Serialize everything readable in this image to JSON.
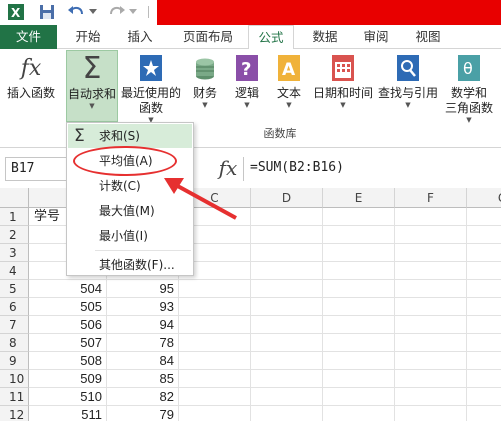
{
  "ribbon_tabs": [
    "文件",
    "开始",
    "插入",
    "页面布局",
    "公式",
    "数据",
    "审阅",
    "视图"
  ],
  "ribbon_buttons": {
    "insert_function": "插入函数",
    "autosum": "自动求和",
    "recent_line1": "最近使用的",
    "recent_line2": "函数",
    "financial": "财务",
    "logical": "逻辑",
    "text": "文本",
    "datetime": "日期和时间",
    "lookup": "查找与引用",
    "math_line1": "数学和",
    "math_line2": "三角函数"
  },
  "group_label": "函数库",
  "name_box": "B17",
  "formula": "=SUM(B2:B16)",
  "fx_label": "fx",
  "menu": {
    "items": [
      "求和(S)",
      "平均值(A)",
      "计数(C)",
      "最大值(M)",
      "最小值(I)",
      "其他函数(F)..."
    ]
  },
  "columns": [
    "C",
    "D",
    "E",
    "F",
    "G"
  ],
  "rows": [
    {
      "n": "1",
      "a": "学号",
      "b": ""
    },
    {
      "n": "2",
      "a": "",
      "b": ""
    },
    {
      "n": "3",
      "a": "",
      "b": ""
    },
    {
      "n": "4",
      "a": "",
      "b": ""
    },
    {
      "n": "5",
      "a": "504",
      "b": "95"
    },
    {
      "n": "6",
      "a": "505",
      "b": "93"
    },
    {
      "n": "7",
      "a": "506",
      "b": "94"
    },
    {
      "n": "8",
      "a": "507",
      "b": "78"
    },
    {
      "n": "9",
      "a": "508",
      "b": "84"
    },
    {
      "n": "10",
      "a": "509",
      "b": "85"
    },
    {
      "n": "11",
      "a": "510",
      "b": "82"
    },
    {
      "n": "12",
      "a": "511",
      "b": "79"
    }
  ],
  "colors": {
    "excel_green": "#217346",
    "highlight": "#e63030",
    "title_red": "#e80000"
  }
}
